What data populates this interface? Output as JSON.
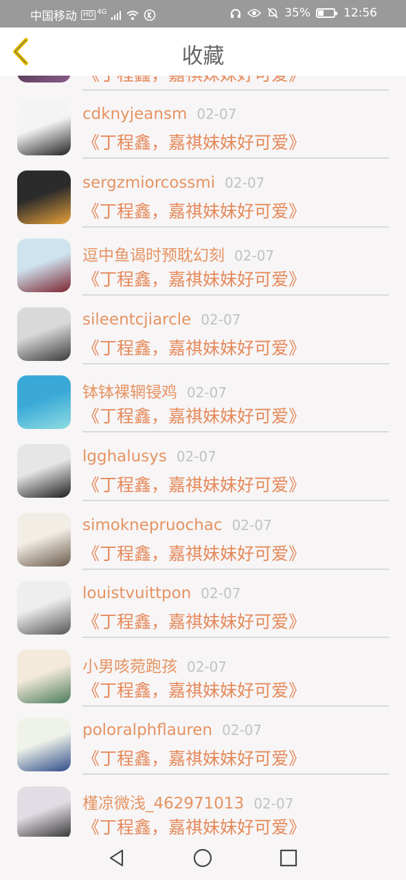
{
  "status": {
    "carrier": "中国移动",
    "hd": "HD",
    "network": "4G",
    "battery_percent": "35%",
    "battery_level": 0.35,
    "time": "12:56"
  },
  "header": {
    "title": "收藏"
  },
  "partial_item": {
    "content": "《丁程鑫，嘉祺妹妹好可爱》"
  },
  "items": [
    {
      "name": "cdknyjeansm",
      "date": "02-07",
      "content": "《丁程鑫，嘉祺妹妹好可爱》",
      "avatar_icon": "avatar-boy-sketch",
      "avatar_colors": [
        "#f4f4f4",
        "#222222"
      ]
    },
    {
      "name": "sergzmiorcossmi",
      "date": "02-07",
      "content": "《丁程鑫，嘉祺妹妹好可爱》",
      "avatar_icon": "avatar-sunset",
      "avatar_colors": [
        "#2b2b2b",
        "#e8a13a"
      ]
    },
    {
      "name": "逗中鱼谒时预耽幻刻",
      "date": "02-07",
      "content": "《丁程鑫，嘉祺妹妹好可爱》",
      "avatar_icon": "avatar-girl",
      "avatar_colors": [
        "#cfe3ef",
        "#7a2430"
      ]
    },
    {
      "name": "sileentcjiarcle",
      "date": "02-07",
      "content": "《丁程鑫，嘉祺妹妹好可爱》",
      "avatar_icon": "avatar-boy-bw",
      "avatar_colors": [
        "#d9d9d9",
        "#3a3a3a"
      ]
    },
    {
      "name": "钵钵裸辋锓鸡",
      "date": "02-07",
      "content": "《丁程鑫，嘉祺妹妹好可爱》",
      "avatar_icon": "avatar-sea-boat",
      "avatar_colors": [
        "#3aa9d8",
        "#8fdde0"
      ]
    },
    {
      "name": "lgghalusys",
      "date": "02-07",
      "content": "《丁程鑫，嘉祺妹妹好可爱》",
      "avatar_icon": "avatar-girl-bw",
      "avatar_colors": [
        "#e6e6e6",
        "#1d1d1d"
      ]
    },
    {
      "name": "simoknepruochac",
      "date": "02-07",
      "content": "《丁程鑫，嘉祺妹妹好可爱》",
      "avatar_icon": "avatar-anime-boy",
      "avatar_colors": [
        "#f2eee6",
        "#6a5a4a"
      ]
    },
    {
      "name": "louistvuittpon",
      "date": "02-07",
      "content": "《丁程鑫，嘉祺妹妹好可爱》",
      "avatar_icon": "avatar-lying-girl",
      "avatar_colors": [
        "#eeeeee",
        "#555555"
      ]
    },
    {
      "name": "小男咳菀跑孩",
      "date": "02-07",
      "content": "《丁程鑫，嘉祺妹妹好可爱》",
      "avatar_icon": "avatar-photo-clips",
      "avatar_colors": [
        "#f3eadb",
        "#4c7a5a"
      ]
    },
    {
      "name": "poloralphflauren",
      "date": "02-07",
      "content": "《丁程鑫，嘉祺妹妹好可爱》",
      "avatar_icon": "avatar-handwritten-note",
      "avatar_colors": [
        "#eef2e8",
        "#2f4c8a"
      ]
    },
    {
      "name": "槿凉微浅_462971013",
      "date": "02-07",
      "content": "《丁程鑫，嘉祺妹妹好可爱》",
      "avatar_icon": "avatar-girl-photo",
      "avatar_colors": [
        "#e2dde4",
        "#2a2a2a"
      ]
    }
  ],
  "colors": {
    "accent_name": "#e59362",
    "accent_content": "#e5895a",
    "date": "#c2c2c2",
    "back_icon": "#e8c200"
  }
}
